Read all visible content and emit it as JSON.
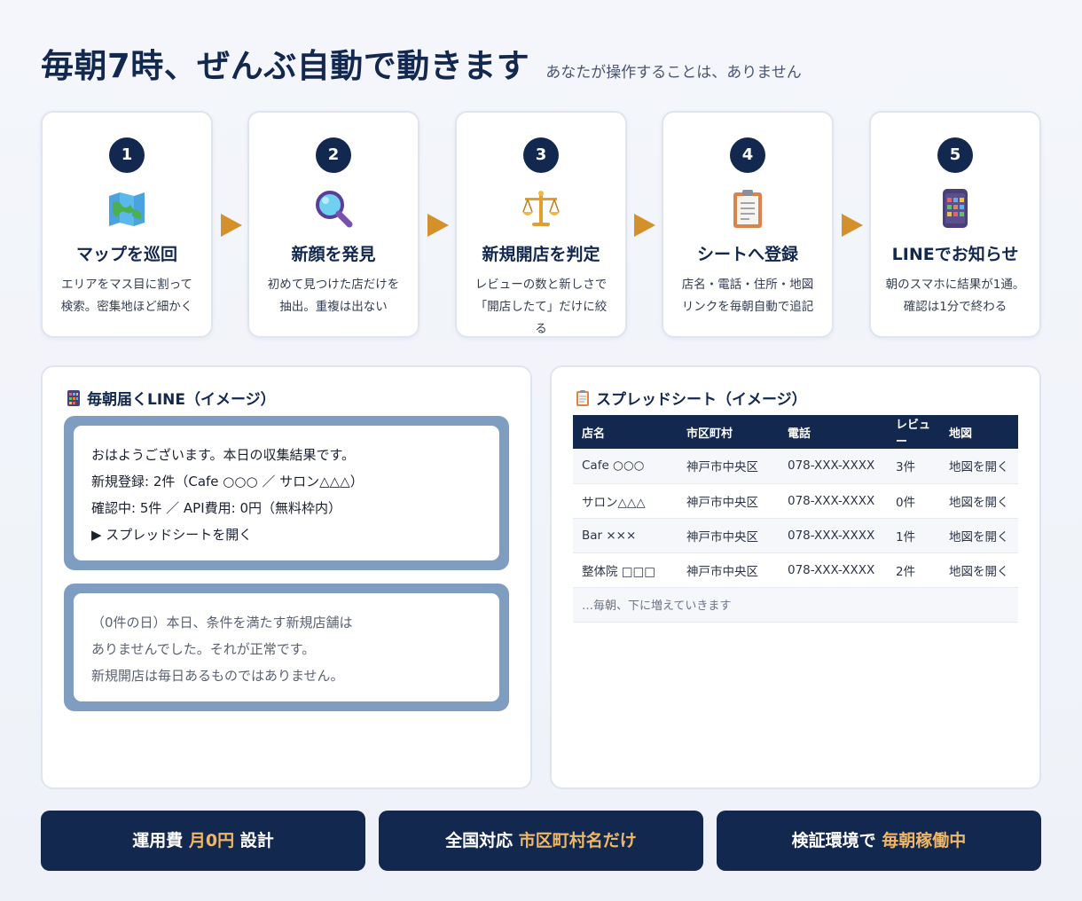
{
  "header": {
    "title": "毎朝7時、ぜんぶ自動で動きます",
    "subtitle": "あなたが操作することは、ありません"
  },
  "steps": [
    {
      "num": "1",
      "icon": "folded-map-icon",
      "title": "マップを巡回",
      "desc": "エリアをマス目に割って検索。密集地ほど細かく"
    },
    {
      "num": "2",
      "icon": "magnifier-icon",
      "title": "新顔を発見",
      "desc": "初めて見つけた店だけを抽出。重複は出ない"
    },
    {
      "num": "3",
      "icon": "scales-icon",
      "title": "新規開店を判定",
      "desc": "レビューの数と新しさで「開店したて」だけに絞る"
    },
    {
      "num": "4",
      "icon": "clipboard-icon",
      "title": "シートへ登録",
      "desc": "店名・電話・住所・地図リンクを毎朝自動で追記"
    },
    {
      "num": "5",
      "icon": "phone-icon",
      "title": "LINEでお知らせ",
      "desc": "朝のスマホに結果が1通。確認は1分で終わる"
    }
  ],
  "line_panel": {
    "title": "毎朝届くLINE（イメージ）",
    "message1": [
      "おはようございます。本日の収集結果です。",
      "新規登録: 2件（Cafe ○○○ ／ サロン△△△）",
      "確認中: 5件 ／ API費用: 0円（無料枠内）",
      "▶ スプレッドシートを開く"
    ],
    "message2": [
      "（0件の日）本日、条件を満たす新規店舗は",
      "ありませんでした。それが正常です。",
      "新規開店は毎日あるものではありません。"
    ]
  },
  "sheet_panel": {
    "title": "スプレッドシート（イメージ）",
    "columns": [
      "店名",
      "市区町村",
      "電話",
      "レビュー",
      "地図"
    ],
    "rows": [
      [
        "Cafe ○○○",
        "神戸市中央区",
        "078-XXX-XXXX",
        "3件",
        "地図を開く"
      ],
      [
        "サロン△△△",
        "神戸市中央区",
        "078-XXX-XXXX",
        "0件",
        "地図を開く"
      ],
      [
        "Bar ×××",
        "神戸市中央区",
        "078-XXX-XXXX",
        "1件",
        "地図を開く"
      ],
      [
        "整体院 □□□",
        "神戸市中央区",
        "078-XXX-XXXX",
        "2件",
        "地図を開く"
      ]
    ],
    "note": "…毎朝、下に増えていきます"
  },
  "badges": [
    {
      "pre": "運用費 ",
      "hl": "月0円",
      "post": " 設計"
    },
    {
      "pre": "全国対応 ",
      "hl": "市区町村名だけ",
      "post": ""
    },
    {
      "pre": "検証環境で ",
      "hl": "毎朝稼働中",
      "post": ""
    }
  ],
  "colors": {
    "navy": "#13284f",
    "accent_orange": "#d4912b",
    "highlight": "#f0b866",
    "bubble_frame": "#7f9dc0"
  }
}
